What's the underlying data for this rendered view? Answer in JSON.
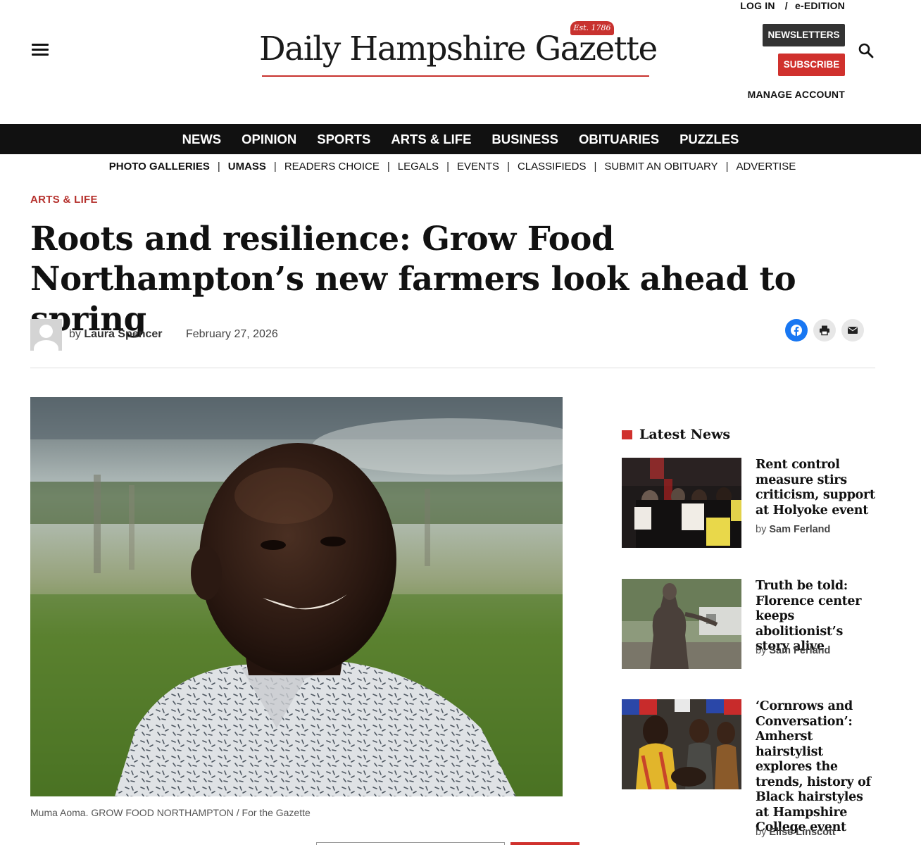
{
  "header": {
    "logo_text": "Daily Hampshire Gazette",
    "logo_est": "Est. 1786",
    "login": "LOG IN",
    "slash": "/",
    "eedition": "e-EDITION",
    "newsletters": "NEWSLETTERS",
    "subscribe": "SUBSCRIBE",
    "manage_account": "MANAGE ACCOUNT"
  },
  "main_nav": [
    "NEWS",
    "OPINION",
    "SPORTS",
    "ARTS & LIFE",
    "BUSINESS",
    "OBITUARIES",
    "PUZZLES"
  ],
  "sub_nav": [
    "PHOTO GALLERIES",
    "UMASS",
    "READERS CHOICE",
    "LEGALS",
    "EVENTS",
    "CLASSIFIEDS",
    "SUBMIT AN OBITUARY",
    "ADVERTISE"
  ],
  "article": {
    "kicker": "ARTS & LIFE",
    "headline": "Roots and resilience: Grow Food Northampton’s new farmers look ahead to spring",
    "by_prefix": "by",
    "author": "Laura Spencer",
    "date": "February 27, 2026",
    "caption": "Muma Aoma. GROW FOOD NORTHAMPTON / For the Gazette"
  },
  "colors": {
    "accent": "#d0312d",
    "kicker": "#b5302c",
    "nav_bg": "#111111",
    "facebook": "#1877f2"
  },
  "sidebar": {
    "heading": "Latest News",
    "stories": [
      {
        "title": "Rent control measure stirs criticism, support at Holyoke event",
        "by_prefix": "by",
        "author": "Sam Ferland"
      },
      {
        "title": "Truth be told: Florence center keeps abolitionist’s story alive",
        "by_prefix": "by",
        "author": "Sam Ferland"
      },
      {
        "title": "‘Cornrows and Conversation’: Amherst hairstylist explores the trends, history of Black hairstyles at Hampshire College event",
        "by_prefix": "by",
        "author": "Elise Linscott"
      }
    ]
  }
}
